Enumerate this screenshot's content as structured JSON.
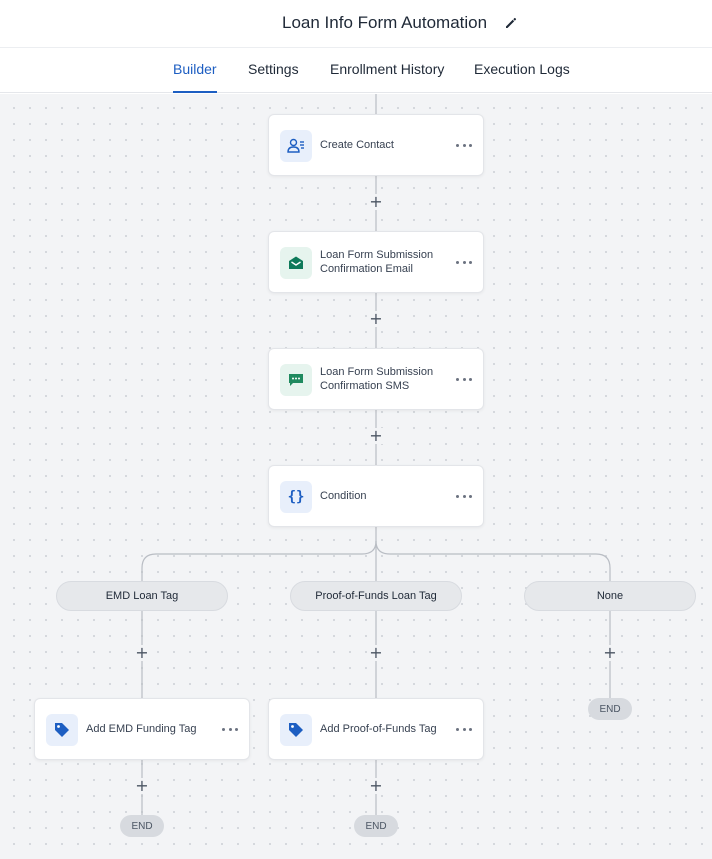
{
  "header": {
    "title": "Loan Info Form Automation"
  },
  "tabs": [
    {
      "label": "Builder",
      "active": true
    },
    {
      "label": "Settings",
      "active": false
    },
    {
      "label": "Enrollment History",
      "active": false
    },
    {
      "label": "Execution Logs",
      "active": false
    }
  ],
  "nodes": [
    {
      "label": "Create Contact",
      "icon": "contact-icon"
    },
    {
      "label": "Loan Form Submission Confirmation Email",
      "icon": "email-icon"
    },
    {
      "label": "Loan Form Submission Confirmation SMS",
      "icon": "sms-icon"
    },
    {
      "label": "Condition",
      "icon": "condition-icon"
    }
  ],
  "branches": [
    {
      "label": "EMD Loan Tag",
      "action": {
        "label": "Add EMD Funding Tag",
        "icon": "tag-icon"
      },
      "end_label": "END"
    },
    {
      "label": "Proof-of-Funds Loan Tag",
      "action": {
        "label": "Add Proof-of-Funds Tag",
        "icon": "tag-icon"
      },
      "end_label": "END"
    },
    {
      "label": "None",
      "end_label": "END"
    }
  ],
  "add_step_symbol": "+",
  "colors": {
    "accent": "#1d5ec2",
    "contact_icon_bg": "#e8effb",
    "email_icon": "#0f7a5a",
    "sms_icon": "#1f8a5f",
    "tag_icon": "#1d5ec2"
  }
}
